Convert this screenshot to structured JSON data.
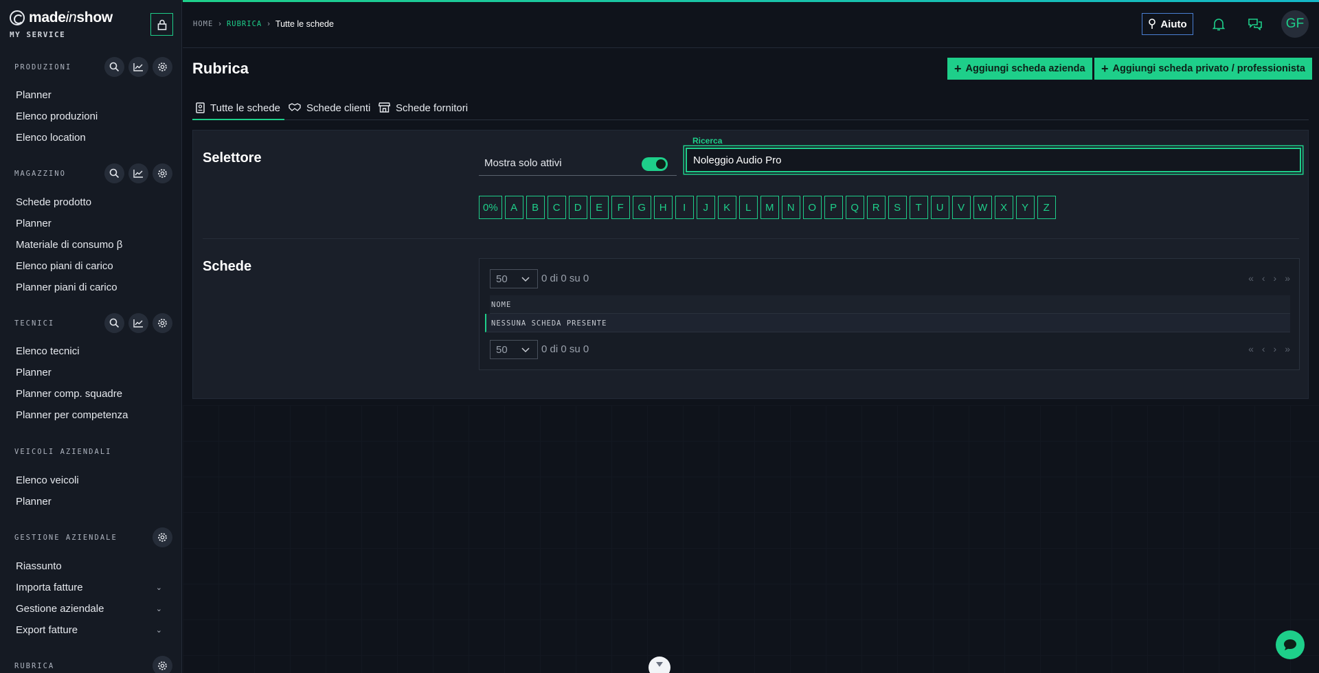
{
  "brand": {
    "name_pre": "made",
    "name_mid": "in",
    "name_post": "show",
    "subtitle": "MY SERVICE"
  },
  "sidebar": {
    "sections": [
      {
        "title": "PRODUZIONI",
        "items": [
          "Planner",
          "Elenco produzioni",
          "Elenco location"
        ]
      },
      {
        "title": "MAGAZZINO",
        "items": [
          "Schede prodotto",
          "Planner",
          "Materiale di consumo β",
          "Elenco piani di carico",
          "Planner piani di carico"
        ]
      },
      {
        "title": "TECNICI",
        "items": [
          "Elenco tecnici",
          "Planner",
          "Planner comp. squadre",
          "Planner per competenza"
        ]
      },
      {
        "title": "VEICOLI AZIENDALI",
        "items": [
          "Elenco veicoli",
          "Planner"
        ]
      },
      {
        "title": "GESTIONE AZIENDALE",
        "items": [
          "Riassunto",
          "Importa fatture",
          "Gestione aziendale",
          "Export fatture"
        ]
      },
      {
        "title": "RUBRICA",
        "items": []
      }
    ]
  },
  "header": {
    "breadcrumb": {
      "home": "HOME",
      "section": "RUBRICA",
      "current": "Tutte le schede"
    },
    "help_label": "Aiuto",
    "avatar_initials": "GF"
  },
  "page": {
    "title": "Rubrica",
    "add_company_label": "Aggiungi scheda azienda",
    "add_private_label": "Aggiungi scheda privato / professionista",
    "tabs": [
      "Tutte le schede",
      "Schede clienti",
      "Schede fornitori"
    ],
    "selector": {
      "title": "Selettore",
      "toggle_label": "Mostra solo attivi",
      "toggle_on": true,
      "search_label": "Ricerca",
      "search_value": "Noleggio Audio Pro",
      "letters": [
        "0%",
        "A",
        "B",
        "C",
        "D",
        "E",
        "F",
        "G",
        "H",
        "I",
        "J",
        "K",
        "L",
        "M",
        "N",
        "O",
        "P",
        "Q",
        "R",
        "S",
        "T",
        "U",
        "V",
        "W",
        "X",
        "Y",
        "Z"
      ]
    },
    "cards": {
      "title": "Schede",
      "page_size": "50",
      "count_text": "0 di 0 su 0",
      "column_name": "NOME",
      "empty_text": "NESSUNA SCHEDA PRESENTE"
    }
  },
  "colors": {
    "accent": "#1ecf8a",
    "bg": "#0f131b",
    "panel": "#1a1f29"
  }
}
